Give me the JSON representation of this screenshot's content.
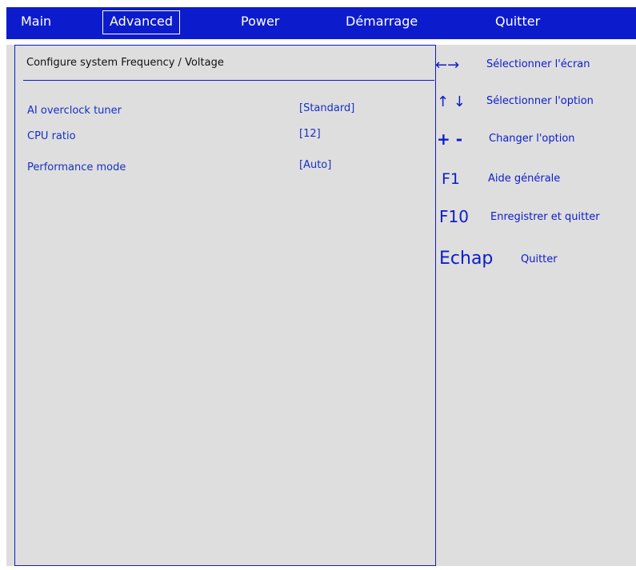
{
  "menubar": {
    "items": [
      "Main",
      "Advanced",
      "Power",
      "Démarrage",
      "Quitter"
    ],
    "active": "Advanced"
  },
  "main": {
    "title": "Configure system Frequency / Voltage",
    "settings": [
      {
        "label": "AI overclock tuner",
        "value": "[Standard]"
      },
      {
        "label": "CPU ratio",
        "value": "[12]"
      },
      {
        "label": "Performance mode",
        "value": "[Auto]"
      }
    ]
  },
  "help": [
    {
      "key": "←→",
      "desc": "Sélectionner l'écran"
    },
    {
      "key": "↑ ↓",
      "desc": "Sélectionner l'option"
    },
    {
      "key": "+ -",
      "desc": "Changer l'option"
    },
    {
      "key": "F1",
      "desc": "Aide générale"
    },
    {
      "key": "F10",
      "desc": "Enregistrer et quitter"
    },
    {
      "key": "Echap",
      "desc": "Quitter"
    }
  ],
  "colors": {
    "menubar_bg": "#0c1ccc",
    "panel_bg": "#dedede",
    "text_blue": "#1630c6"
  }
}
